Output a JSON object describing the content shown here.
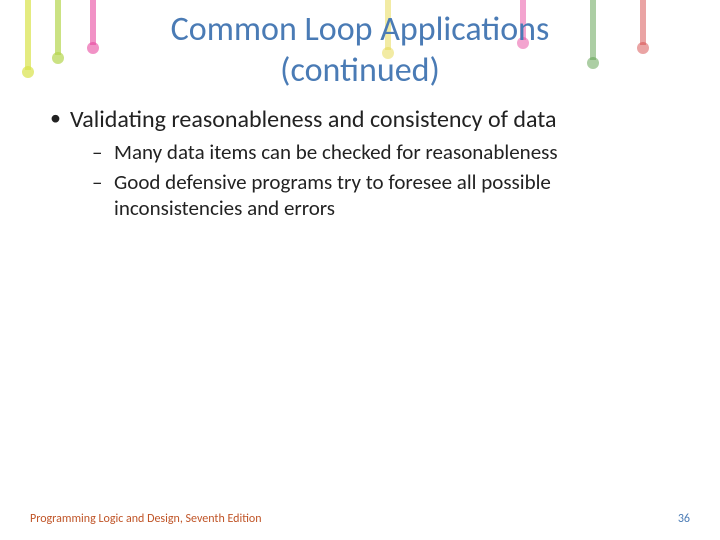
{
  "title_line1": "Common Loop Applications",
  "title_line2": "(continued)",
  "bullets": {
    "main": "Validating reasonableness and consistency of data",
    "sub1": "Many data items can be checked for reasonableness",
    "sub2": "Good defensive programs try to foresee all possible inconsistencies and errors"
  },
  "footer": {
    "book": "Programming Logic and Design, Seventh Edition",
    "page": "36"
  }
}
